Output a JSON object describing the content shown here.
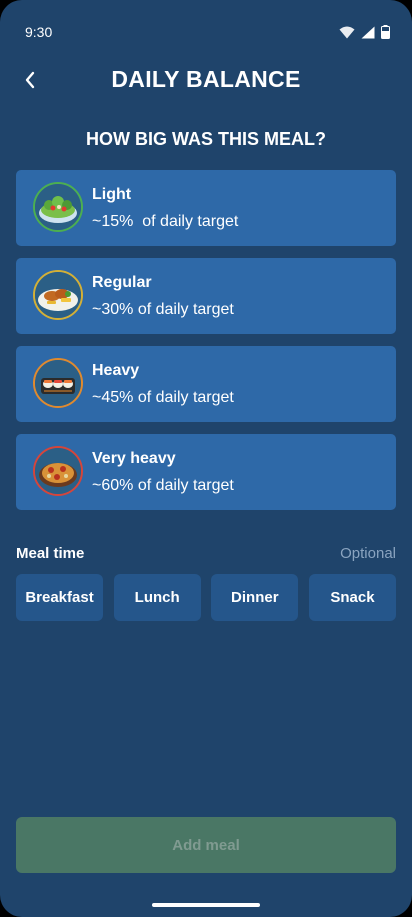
{
  "status": {
    "time": "9:30"
  },
  "header": {
    "title": "DAILY BALANCE"
  },
  "question": "HOW BIG WAS THIS MEAL?",
  "options": [
    {
      "title": "Light",
      "subtitle": "~15%  of daily target",
      "ring_color": "#4caf50"
    },
    {
      "title": "Regular",
      "subtitle": "~30% of daily target",
      "ring_color": "#d4b036"
    },
    {
      "title": "Heavy",
      "subtitle": "~45% of daily target",
      "ring_color": "#e08a2e"
    },
    {
      "title": "Very heavy",
      "subtitle": "~60% of daily target",
      "ring_color": "#d6453a"
    }
  ],
  "meal_time": {
    "label": "Meal time",
    "optional": "Optional",
    "options": [
      "Breakfast",
      "Lunch",
      "Dinner",
      "Snack"
    ]
  },
  "add_button": {
    "label": "Add meal"
  },
  "colors": {
    "background": "#1f446b",
    "card": "#2e69a8",
    "chip": "#25568b",
    "add_button_disabled": "#4a7765"
  },
  "icons": [
    "back-chevron-icon",
    "wifi-icon",
    "signal-icon",
    "battery-icon",
    "salad-icon",
    "chicken-plate-icon",
    "sushi-icon",
    "pizza-icon"
  ]
}
